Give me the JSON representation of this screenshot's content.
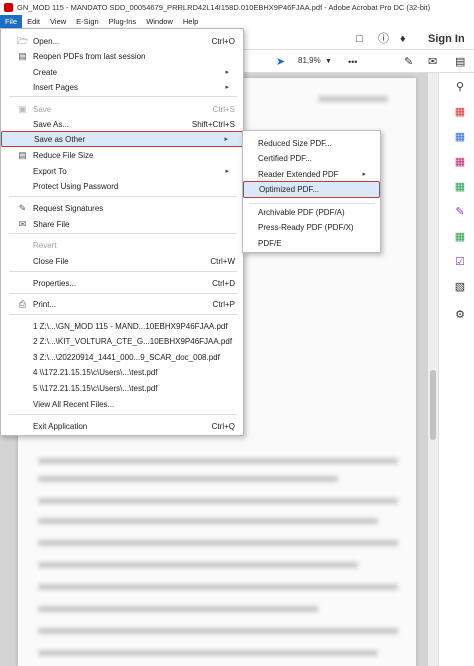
{
  "window": {
    "title": "GN_MOD 115 - MANDATO SDD_00054679_PRRLRD42L14I158D.010EBHX9P46FJAA.pdf - Adobe Acrobat Pro DC (32-bit)"
  },
  "menubar": [
    {
      "label": "File"
    },
    {
      "label": "Edit"
    },
    {
      "label": "View"
    },
    {
      "label": "E-Sign"
    },
    {
      "label": "Plug-Ins"
    },
    {
      "label": "Window"
    },
    {
      "label": "Help"
    }
  ],
  "toolbar": {
    "sign_in": "Sign In",
    "zoom": "81,9%",
    "more": "•••"
  },
  "file_menu": {
    "open": {
      "label": "Open...",
      "shortcut": "Ctrl+O"
    },
    "reopen": {
      "label": "Reopen PDFs from last session"
    },
    "create": {
      "label": "Create"
    },
    "insert_pages": {
      "label": "Insert Pages"
    },
    "save": {
      "label": "Save",
      "shortcut": "Ctrl+S"
    },
    "save_as": {
      "label": "Save As...",
      "shortcut": "Shift+Ctrl+S"
    },
    "save_as_other": {
      "label": "Save as Other"
    },
    "reduce": {
      "label": "Reduce File Size"
    },
    "export_to": {
      "label": "Export To"
    },
    "protect": {
      "label": "Protect Using Password"
    },
    "request_sig": {
      "label": "Request Signatures"
    },
    "share": {
      "label": "Share File"
    },
    "revert": {
      "label": "Revert"
    },
    "close": {
      "label": "Close File",
      "shortcut": "Ctrl+W"
    },
    "properties": {
      "label": "Properties...",
      "shortcut": "Ctrl+D"
    },
    "print": {
      "label": "Print...",
      "shortcut": "Ctrl+P"
    },
    "recent": [
      "1 Z:\\...\\GN_MOD 115 - MAND...10EBHX9P46FJAA.pdf",
      "2 Z:\\...\\KIT_VOLTURA_CTE_G...10EBHX9P46FJAA.pdf",
      "3 Z:\\...\\20220914_1441_000...9_SCAR_doc_008.pdf",
      "4 \\\\172.21.15.15\\c\\Users\\...\\test.pdf",
      "5 \\\\172.21.15.15\\c\\Users\\...\\test.pdf"
    ],
    "view_all": {
      "label": "View All Recent Files..."
    },
    "exit": {
      "label": "Exit Application",
      "shortcut": "Ctrl+Q"
    }
  },
  "submenu": {
    "reduced": "Reduced Size PDF...",
    "certified": "Certified PDF...",
    "reader_ext": "Reader Extended PDF",
    "optimized": "Optimized PDF...",
    "archivable": "Archivable PDF (PDF/A)",
    "press_ready": "Press-Ready PDF (PDF/X)",
    "pdfe": "PDF/E"
  },
  "colors": {
    "accent": "#1a6fc4",
    "highlight_border": "#c8393b"
  }
}
